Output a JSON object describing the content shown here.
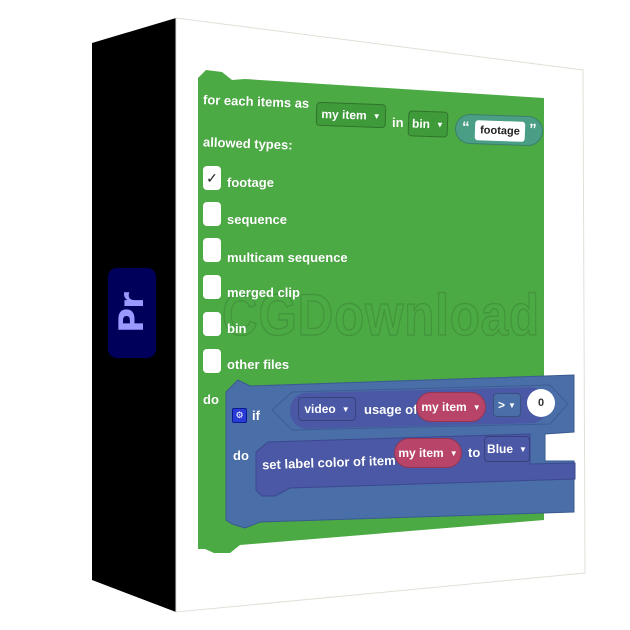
{
  "box": {
    "spine_logo": "Pr",
    "spine_logo_colors": {
      "background": "#00005b",
      "text": "#9999ff"
    },
    "watermark": "CGDownload"
  },
  "colors": {
    "loop_block": "#4caa44",
    "logic_block": "#4a6ea8",
    "action_block": "#4a58a6",
    "variable_pill": "#b8446a",
    "text_block": "#4a9e86"
  },
  "loop_block": {
    "prefix": "for each items as",
    "variable": "my item",
    "in_label": "in",
    "source": "bin",
    "text_open_quote": "“",
    "text_value": "footage",
    "text_close_quote": "”",
    "allowed_label": "allowed types:",
    "types": [
      {
        "label": "footage",
        "checked": true,
        "check_glyph": "✓"
      },
      {
        "label": "sequence",
        "checked": false,
        "check_glyph": ""
      },
      {
        "label": "multicam sequence",
        "checked": false,
        "check_glyph": ""
      },
      {
        "label": "merged clip",
        "checked": false,
        "check_glyph": ""
      },
      {
        "label": "bin",
        "checked": false,
        "check_glyph": ""
      },
      {
        "label": "other files",
        "checked": false,
        "check_glyph": ""
      }
    ],
    "do_label": "do"
  },
  "if_block": {
    "gear_icon": "⚙",
    "if_label": "if",
    "condition": {
      "media": "video",
      "usage_label": "usage of",
      "variable": "my item",
      "operator": ">",
      "value": "0"
    },
    "do_label": "do",
    "action": {
      "label": "set label color of item",
      "variable": "my item",
      "to_label": "to",
      "color": "Blue"
    }
  },
  "dropdown_arrow": "▼"
}
